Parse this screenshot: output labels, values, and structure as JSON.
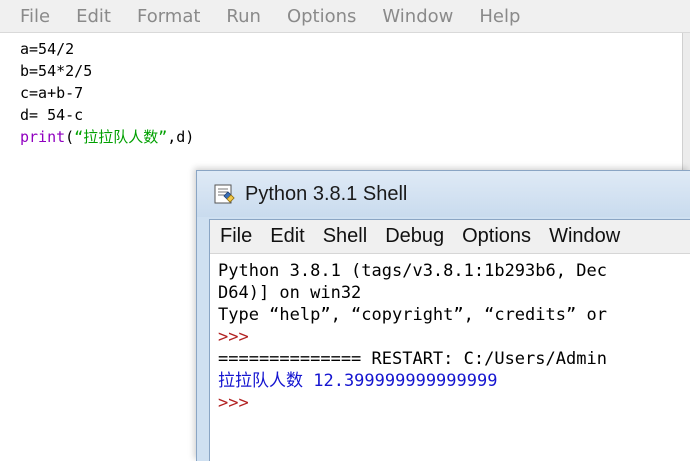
{
  "editor": {
    "menu": [
      "File",
      "Edit",
      "Format",
      "Run",
      "Options",
      "Window",
      "Help"
    ],
    "code": {
      "line1": "a=54/2",
      "line2": "b=54*2/5",
      "line3": "c=a+b-7",
      "line4": "d= 54-c",
      "line5": {
        "func": "print",
        "open": "(",
        "string": "“拉拉队人数”",
        "rest": ",d)"
      }
    }
  },
  "shell": {
    "title": "Python 3.8.1 Shell",
    "icon": "python-shell-icon",
    "menu": [
      "File",
      "Edit",
      "Shell",
      "Debug",
      "Options",
      "Window"
    ],
    "lines": {
      "banner1": "Python 3.8.1 (tags/v3.8.1:1b293b6, Dec",
      "banner2": "D64)] on win32",
      "banner3": "Type “help”, “copyright”, “credits” or",
      "prompt1": ">>>",
      "restart": "============== RESTART: C:/Users/Admin",
      "output": "拉拉队人数 12.399999999999999",
      "prompt2": ">>>"
    }
  },
  "colors": {
    "builtin": "#9000c0",
    "string": "#00a000",
    "prompt": "#b22222",
    "output": "#1515d0",
    "menu_disabled_gray": "#8a8a8a"
  }
}
